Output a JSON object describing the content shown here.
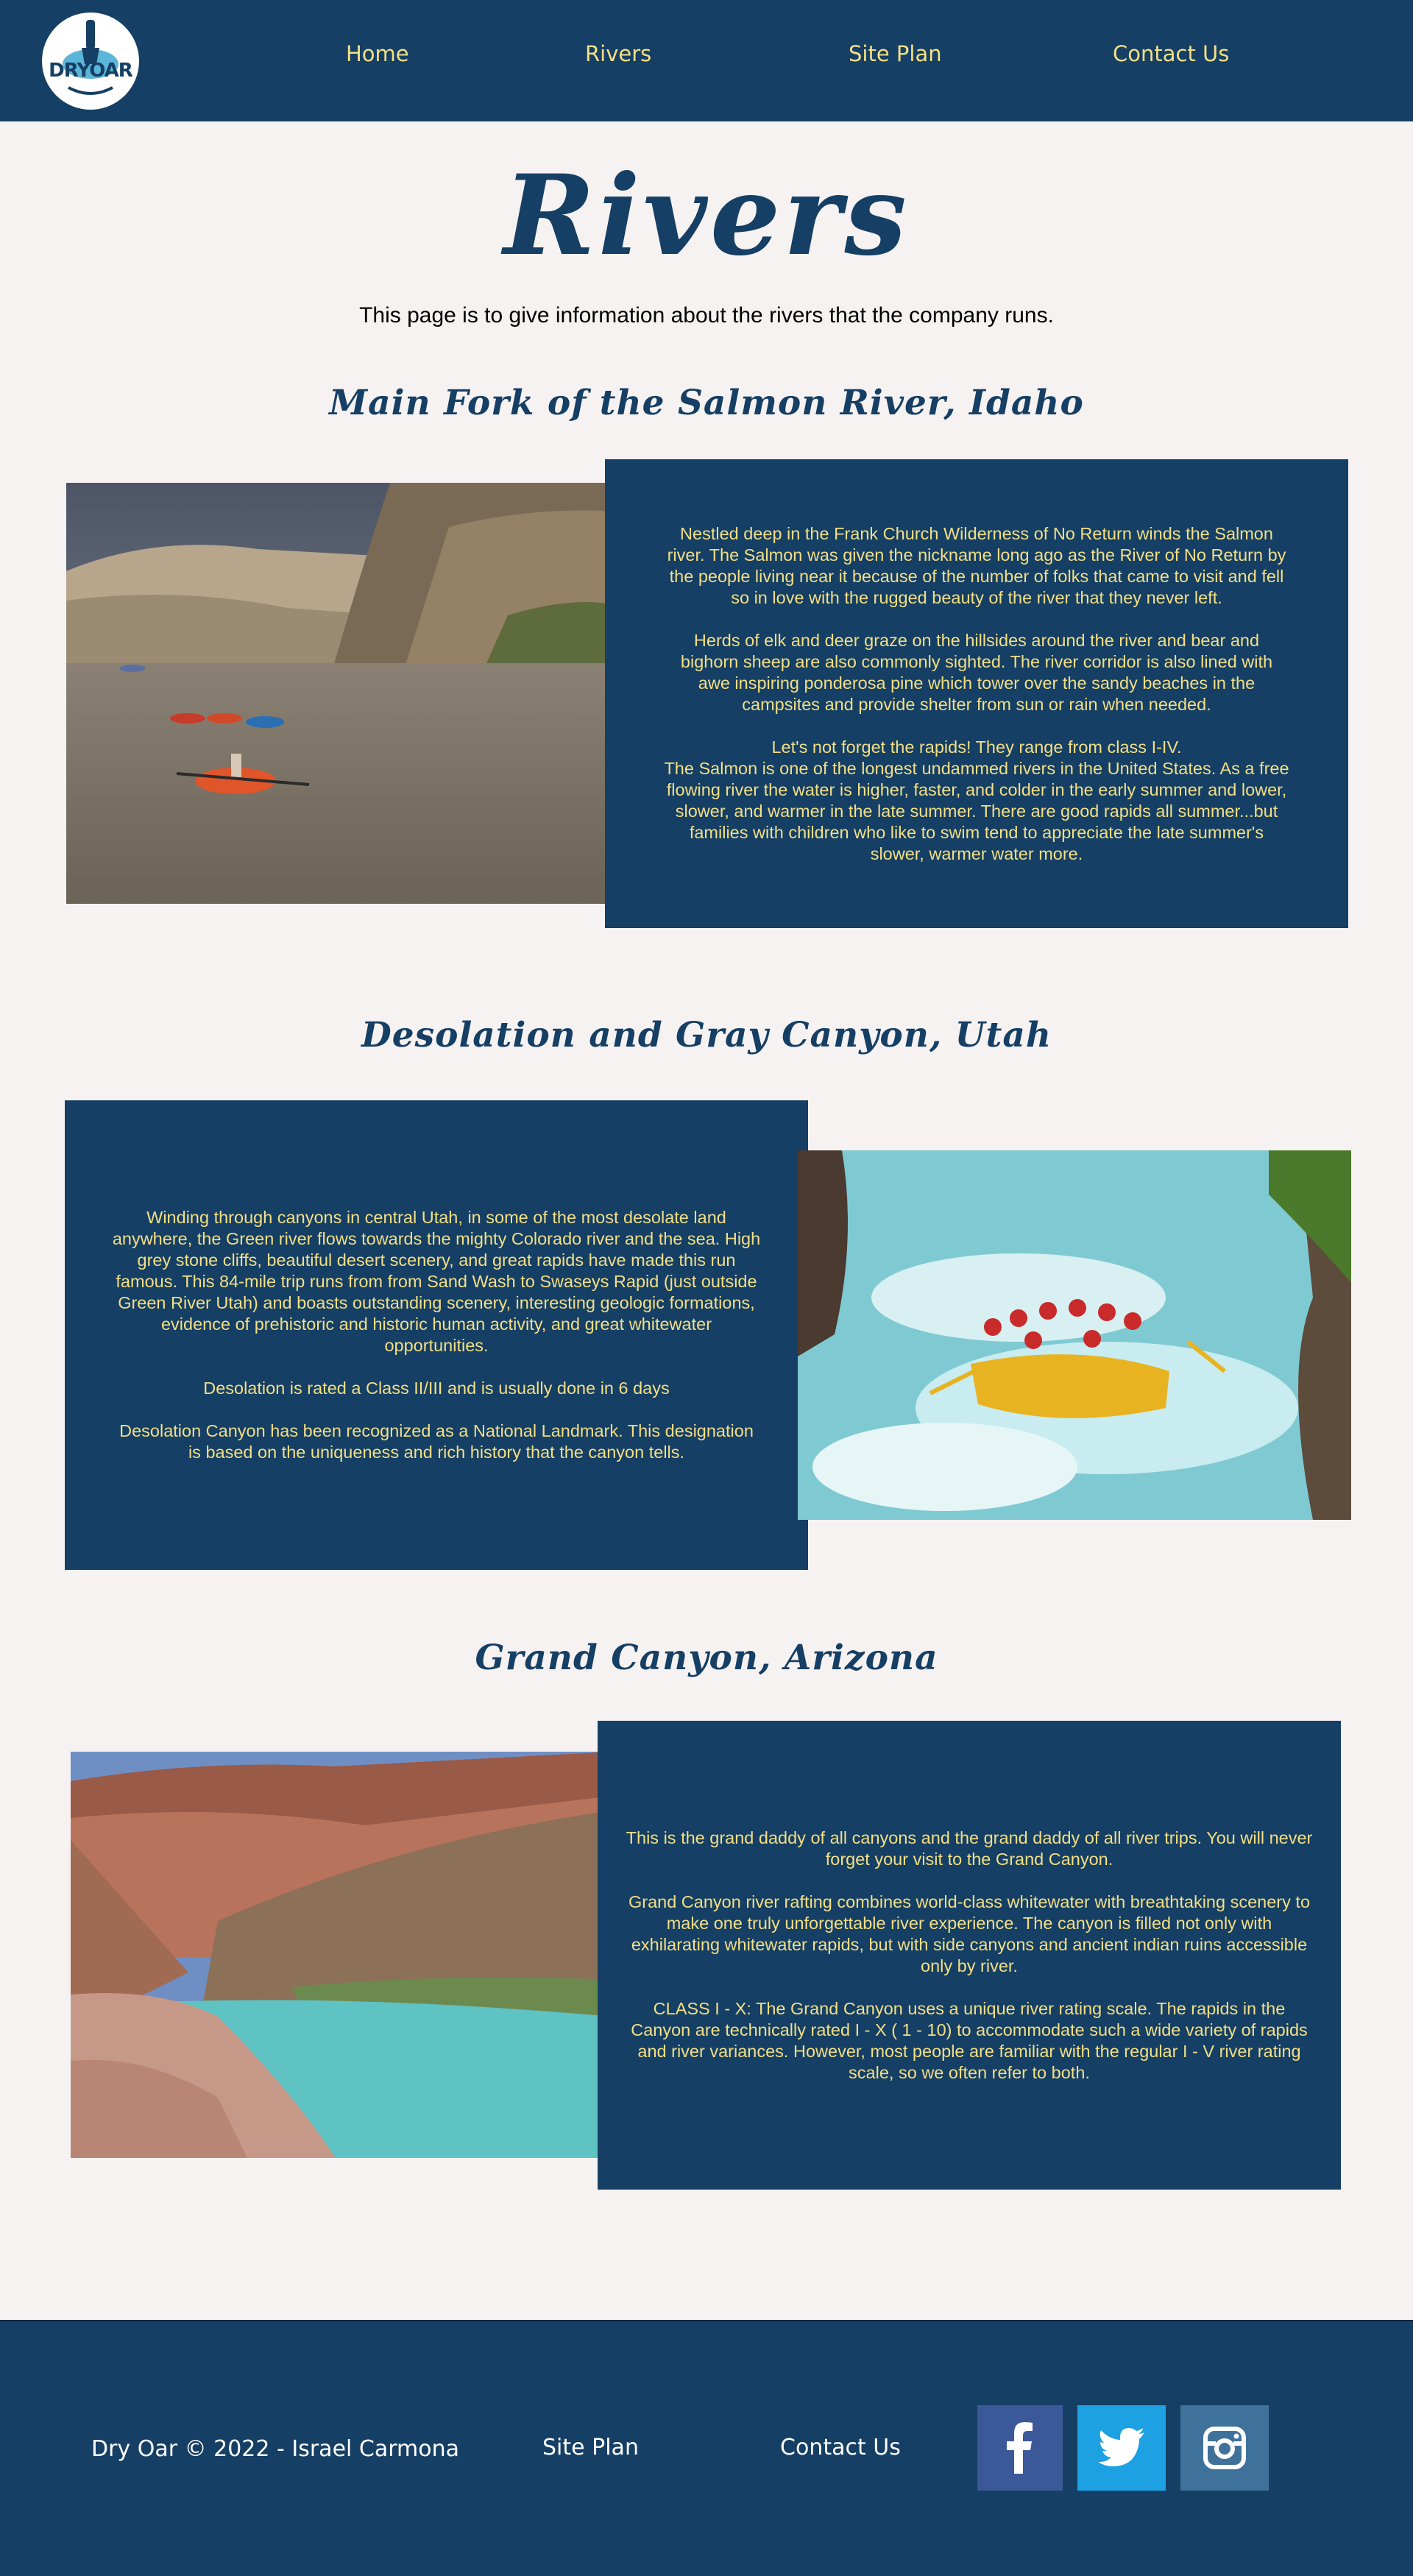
{
  "header": {
    "logo_text": "DRYOAR",
    "nav": {
      "home": "Home",
      "rivers": "Rivers",
      "site_plan": "Site Plan",
      "contact": "Contact Us"
    }
  },
  "page": {
    "title": "Rivers",
    "intro": "This page is to give information about the rivers that the company runs."
  },
  "sections": [
    {
      "title": "Main Fork of the Salmon River, Idaho",
      "paragraphs": [
        "Nestled deep in the Frank Church Wilderness of No Return winds the Salmon river. The Salmon was given the nickname long ago as the River of No Return by the people living near it because of the number of folks that came to visit and fell so in love with the rugged beauty of the river that they never left.",
        "Herds of elk and deer graze on the hillsides around the river and bear and bighorn sheep are also commonly sighted. The river corridor is also lined with awe inspiring ponderosa pine which tower over the sandy beaches in the campsites and provide shelter from sun or rain when needed.",
        "Let's not forget the rapids! They range from class I-IV.",
        "The Salmon is one of the longest undammed rivers in the United States. As a free flowing river the water is higher, faster, and colder in the early summer and lower, slower, and warmer in the late summer. There are good rapids all summer...but families with children who like to swim tend to appreciate the late summer's slower, warmer water more."
      ]
    },
    {
      "title": "Desolation and Gray Canyon, Utah",
      "paragraphs": [
        "Winding through canyons in central Utah, in some of the most desolate land anywhere, the Green river flows towards the mighty Colorado river and the sea. High grey stone cliffs, beautiful desert scenery, and great rapids have made this run famous. This 84-mile trip runs from from Sand Wash to Swaseys Rapid (just outside Green River Utah) and boasts outstanding scenery, interesting geologic formations, evidence of prehistoric and historic human activity, and great whitewater opportunities.",
        "Desolation is rated a Class II/III and is usually done in 6 days",
        "Desolation Canyon has been recognized as a National Landmark. This designation is based on the uniqueness and rich history that the canyon tells."
      ]
    },
    {
      "title": "Grand Canyon, Arizona",
      "paragraphs": [
        "This is the grand daddy of all canyons and the grand daddy of all river trips. You will never forget your visit to the Grand Canyon.",
        "Grand Canyon river rafting combines world-class whitewater with breathtaking scenery to make one truly unforgettable river experience. The canyon is filled not only with exhilarating whitewater rapids, but with side canyons and ancient indian ruins accessible only by river.",
        "CLASS I - X: The Grand Canyon uses a unique river rating scale. The rapids in the Canyon are technically rated I - X ( 1 - 10) to accommodate such a wide variety of rapids and river variances. However, most people are familiar with the regular I - V river rating scale, so we often refer to both."
      ]
    }
  ],
  "footer": {
    "copyright": "Dry Oar © 2022 - Israel Carmona",
    "site_plan": "Site Plan",
    "contact": "Contact Us",
    "social": [
      {
        "name": "facebook-icon",
        "color": "#3b5998"
      },
      {
        "name": "twitter-icon",
        "color": "#1da1e2"
      },
      {
        "name": "instagram-icon",
        "color": "#3f729b"
      }
    ]
  },
  "colors": {
    "navy": "#153f64",
    "gold": "#f4df85",
    "page_bg": "#f7f2f2"
  }
}
